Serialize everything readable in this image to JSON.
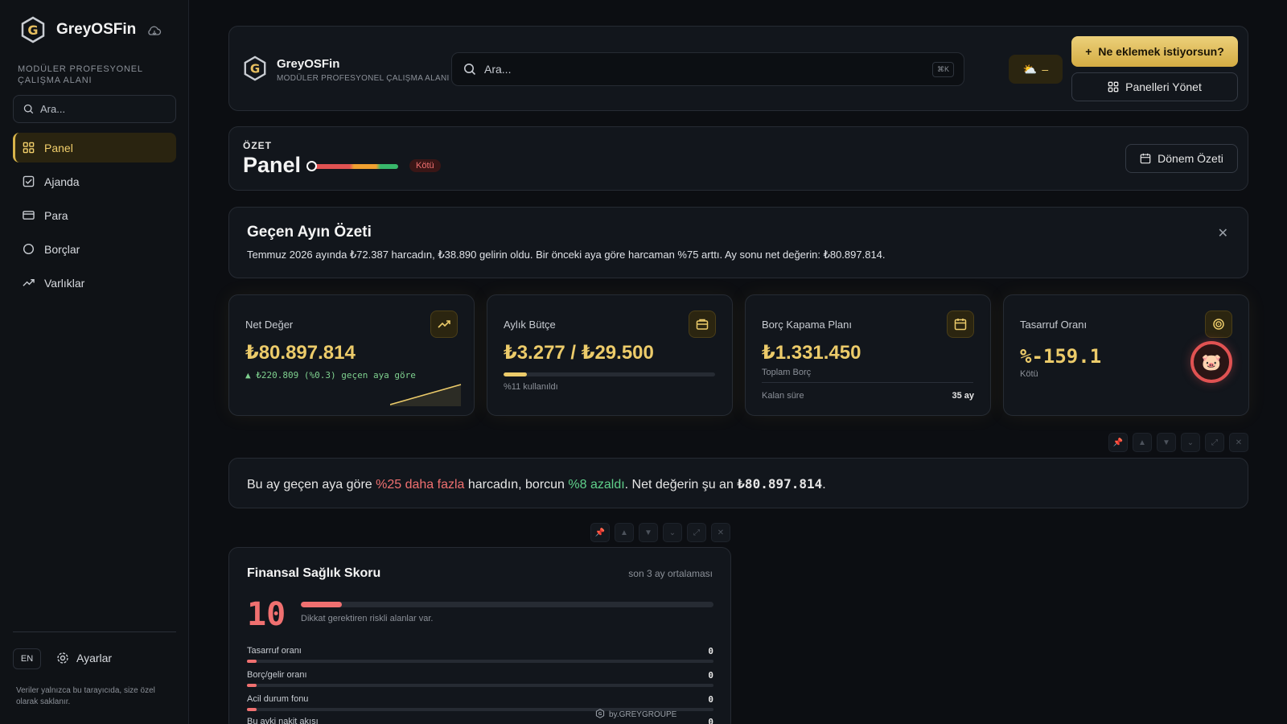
{
  "sidebar": {
    "brand": "GreyOSFin",
    "tagline": "MODÜLER PROFESYONEL ÇALIŞMA ALANI",
    "search_placeholder": "Ara...",
    "items": [
      {
        "label": "Panel",
        "icon": "grid-icon",
        "active": true
      },
      {
        "label": "Ajanda",
        "icon": "check-square-icon"
      },
      {
        "label": "Para",
        "icon": "card-icon"
      },
      {
        "label": "Borçlar",
        "icon": "circle-icon"
      },
      {
        "label": "Varlıklar",
        "icon": "trend-up-icon"
      }
    ],
    "lang": "EN",
    "settings_label": "Ayarlar",
    "note": "Veriler yalnızca bu tarayıcıda, size özel olarak saklanır."
  },
  "topbar": {
    "brand": "GreyOSFin",
    "tagline": "MODÜLER PROFESYONEL ÇALIŞMA ALANI",
    "search_placeholder": "Ara...",
    "shortcut": "⌘K",
    "weather_icon": "⛅",
    "weather_value": "–",
    "primary_label": "Ne eklemek istiyorsun?",
    "manage_label": "Panelleri Yönet"
  },
  "panel_header": {
    "eyebrow": "ÖZET",
    "title": "Panel",
    "health_badge": "Kötü",
    "period_label": "Dönem Özeti"
  },
  "summary": {
    "title": "Geçen Ayın Özeti",
    "text": "Temmuz 2026 ayında ₺72.387 harcadın, ₺38.890 gelirin oldu. Bir önceki aya göre harcaman %75 arttı. Ay sonu net değerin: ₺80.897.814."
  },
  "stats": {
    "net": {
      "label": "Net Değer",
      "value": "₺80.897.814",
      "delta": "▲ ₺220.809 (%0.3) geçen aya göre"
    },
    "budget": {
      "label": "Aylık Bütçe",
      "value": "₺3.277 / ₺29.500",
      "used": "%11 kullanıldı",
      "used_fraction": 0.11
    },
    "debt": {
      "label": "Borç Kapama Planı",
      "value": "₺1.331.450",
      "sub": "Toplam Borç",
      "remaining_label": "Kalan süre",
      "remaining_value": "35 ay"
    },
    "savings": {
      "label": "Tasarruf Oranı",
      "value": "%-159.1",
      "status": "Kötü",
      "icon": "🐷"
    }
  },
  "insight": {
    "p1": "Bu ay geçen aya göre ",
    "h1": "%25 daha fazla",
    "p2": " harcadın, borcun ",
    "h2": "%8 azaldı",
    "p3": ". Net değerin şu an ",
    "h3": "₺80.897.814",
    "p4": "."
  },
  "score": {
    "title": "Finansal Sağlık Skoru",
    "subtitle": "son 3 ay ortalaması",
    "value": "10",
    "fraction": 0.1,
    "note": "Dikkat gerektiren riskli alanlar var.",
    "metrics": [
      {
        "label": "Tasarruf oranı",
        "value": "0"
      },
      {
        "label": "Borç/gelir oranı",
        "value": "0"
      },
      {
        "label": "Acil durum fonu",
        "value": "0"
      },
      {
        "label": "Bu ayki nakit akışı",
        "value": "0"
      }
    ],
    "credit": "by.GREYGROUPE"
  },
  "colors": {
    "accent": "#eccb6a",
    "danger": "#f07070",
    "success": "#5fd08a"
  }
}
